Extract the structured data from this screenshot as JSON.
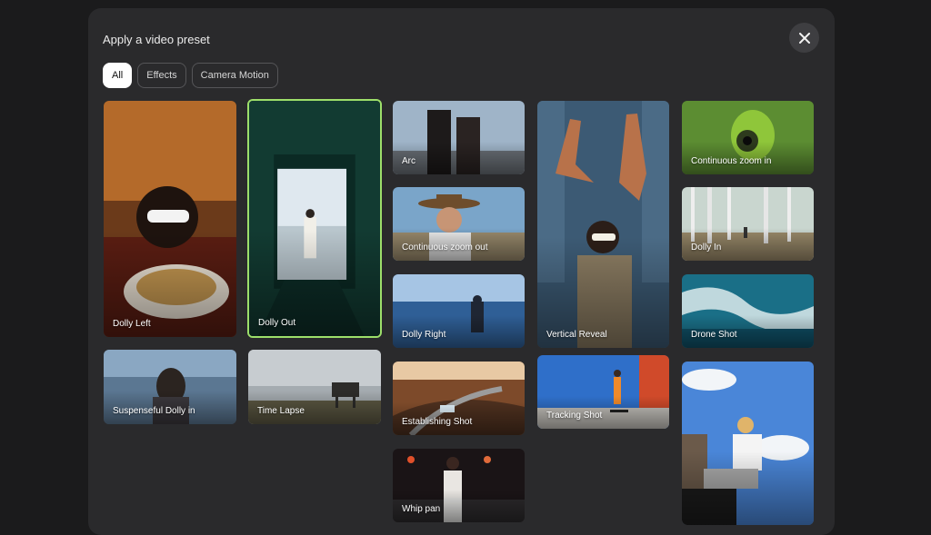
{
  "dialog": {
    "title": "Apply a video preset",
    "close_icon": "close-icon"
  },
  "tabs": [
    {
      "label": "All",
      "active": true
    },
    {
      "label": "Effects",
      "active": false
    },
    {
      "label": "Camera Motion",
      "active": false
    }
  ],
  "presets": [
    {
      "label": "Dolly Left",
      "selected": false
    },
    {
      "label": "Dolly Out",
      "selected": true
    },
    {
      "label": "Suspenseful Dolly in",
      "selected": false
    },
    {
      "label": "Time Lapse",
      "selected": false
    },
    {
      "label": "Arc",
      "selected": false
    },
    {
      "label": "Continuous zoom out",
      "selected": false
    },
    {
      "label": "Dolly Right",
      "selected": false
    },
    {
      "label": "Establishing Shot",
      "selected": false
    },
    {
      "label": "Whip pan",
      "selected": false
    },
    {
      "label": "Vertical Reveal",
      "selected": false
    },
    {
      "label": "Tracking Shot",
      "selected": false
    },
    {
      "label": "Continuous zoom in",
      "selected": false
    },
    {
      "label": "Dolly In",
      "selected": false
    },
    {
      "label": "Drone Shot",
      "selected": false
    },
    {
      "label": "",
      "selected": false
    }
  ],
  "colors": {
    "accent_selected": "#9ddf6a",
    "modal_bg": "#2a2a2c"
  }
}
